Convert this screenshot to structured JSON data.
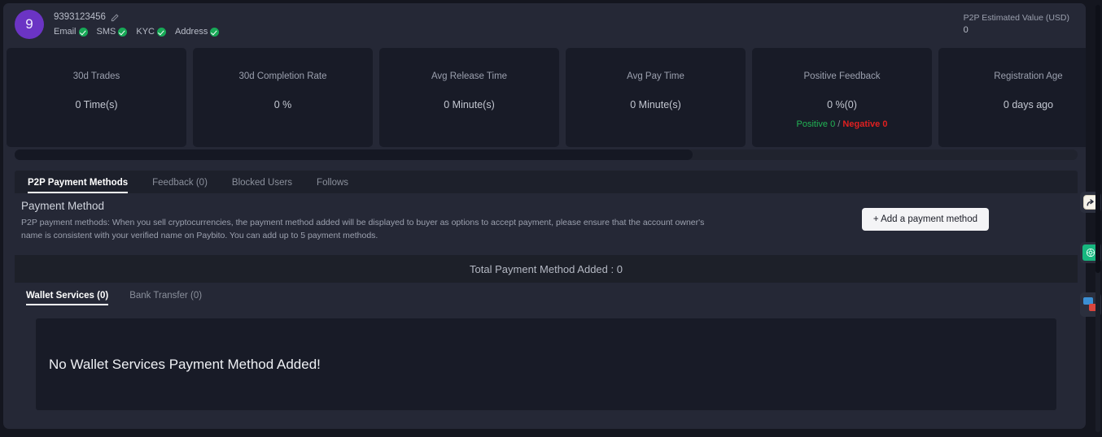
{
  "header": {
    "avatar_initial": "9",
    "user_id": "9393123456",
    "edit_icon": "edit-pencil-icon",
    "verifications": [
      {
        "label": "Email",
        "verified": true
      },
      {
        "label": "SMS",
        "verified": true
      },
      {
        "label": "KYC",
        "verified": true
      },
      {
        "label": "Address",
        "verified": true
      }
    ],
    "p2p_estimated_label": "P2P Estimated Value (USD)",
    "p2p_estimated_value": "0"
  },
  "stats": [
    {
      "title": "30d Trades",
      "value": "0 Time(s)"
    },
    {
      "title": "30d Completion Rate",
      "value": "0 %"
    },
    {
      "title": "Avg Release Time",
      "value": "0 Minute(s)"
    },
    {
      "title": "Avg Pay Time",
      "value": "0 Minute(s)"
    },
    {
      "title": "Positive Feedback",
      "value": "0 %(0)",
      "positive": "Positive 0",
      "separator": "/",
      "negative": "Negative 0"
    },
    {
      "title": "Registration Age",
      "value": "0 days ago"
    }
  ],
  "tabs": [
    {
      "label": "P2P Payment Methods",
      "active": true
    },
    {
      "label": "Feedback (0)",
      "active": false
    },
    {
      "label": "Blocked Users",
      "active": false
    },
    {
      "label": "Follows",
      "active": false
    }
  ],
  "payment_method": {
    "title": "Payment Method",
    "description": "P2P payment methods: When you sell cryptocurrencies, the payment method added will be displayed to buyer as options to accept payment, please ensure that the account owner's name is consistent with your verified name on Paybito. You can add up to 5 payment methods.",
    "add_button_label": "+ Add a payment method",
    "total_label": "Total Payment Method Added : 0"
  },
  "subtabs": [
    {
      "label": "Wallet Services (0)",
      "active": true
    },
    {
      "label": "Bank Transfer (0)",
      "active": false
    }
  ],
  "empty_state": {
    "message": "No Wallet Services Payment Method Added!"
  },
  "floating_widgets": [
    {
      "name": "share-icon",
      "color": "#f6f3ea"
    },
    {
      "name": "green-badge-icon",
      "color": "#17b77f"
    },
    {
      "name": "chat-bubbles-icon",
      "color": "#3b8fd4"
    }
  ],
  "colors": {
    "page_background": "#14161f",
    "card_background": "#252836",
    "panel_background": "#181b27",
    "accent_purple": "#6b34c4",
    "positive_green": "#22b455",
    "negative_red": "#e02020"
  }
}
